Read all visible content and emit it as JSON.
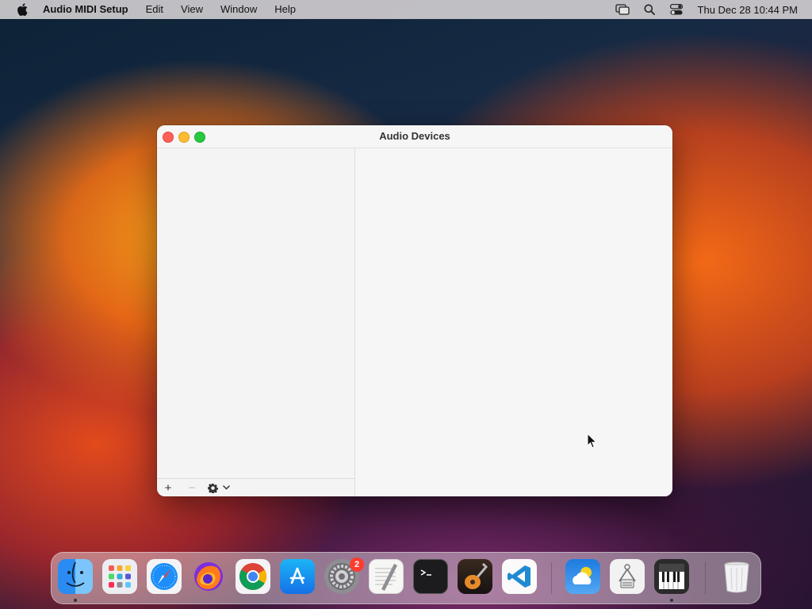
{
  "menubar": {
    "app_name": "Audio MIDI Setup",
    "menus": [
      "Edit",
      "View",
      "Window",
      "Help"
    ],
    "clock": "Thu Dec 28  10:44 PM"
  },
  "window": {
    "title": "Audio Devices",
    "sidebar_footer": {
      "add": "+",
      "remove": "−",
      "action_chevron": "⌄"
    }
  },
  "dock": {
    "system_settings_badge": "2"
  }
}
